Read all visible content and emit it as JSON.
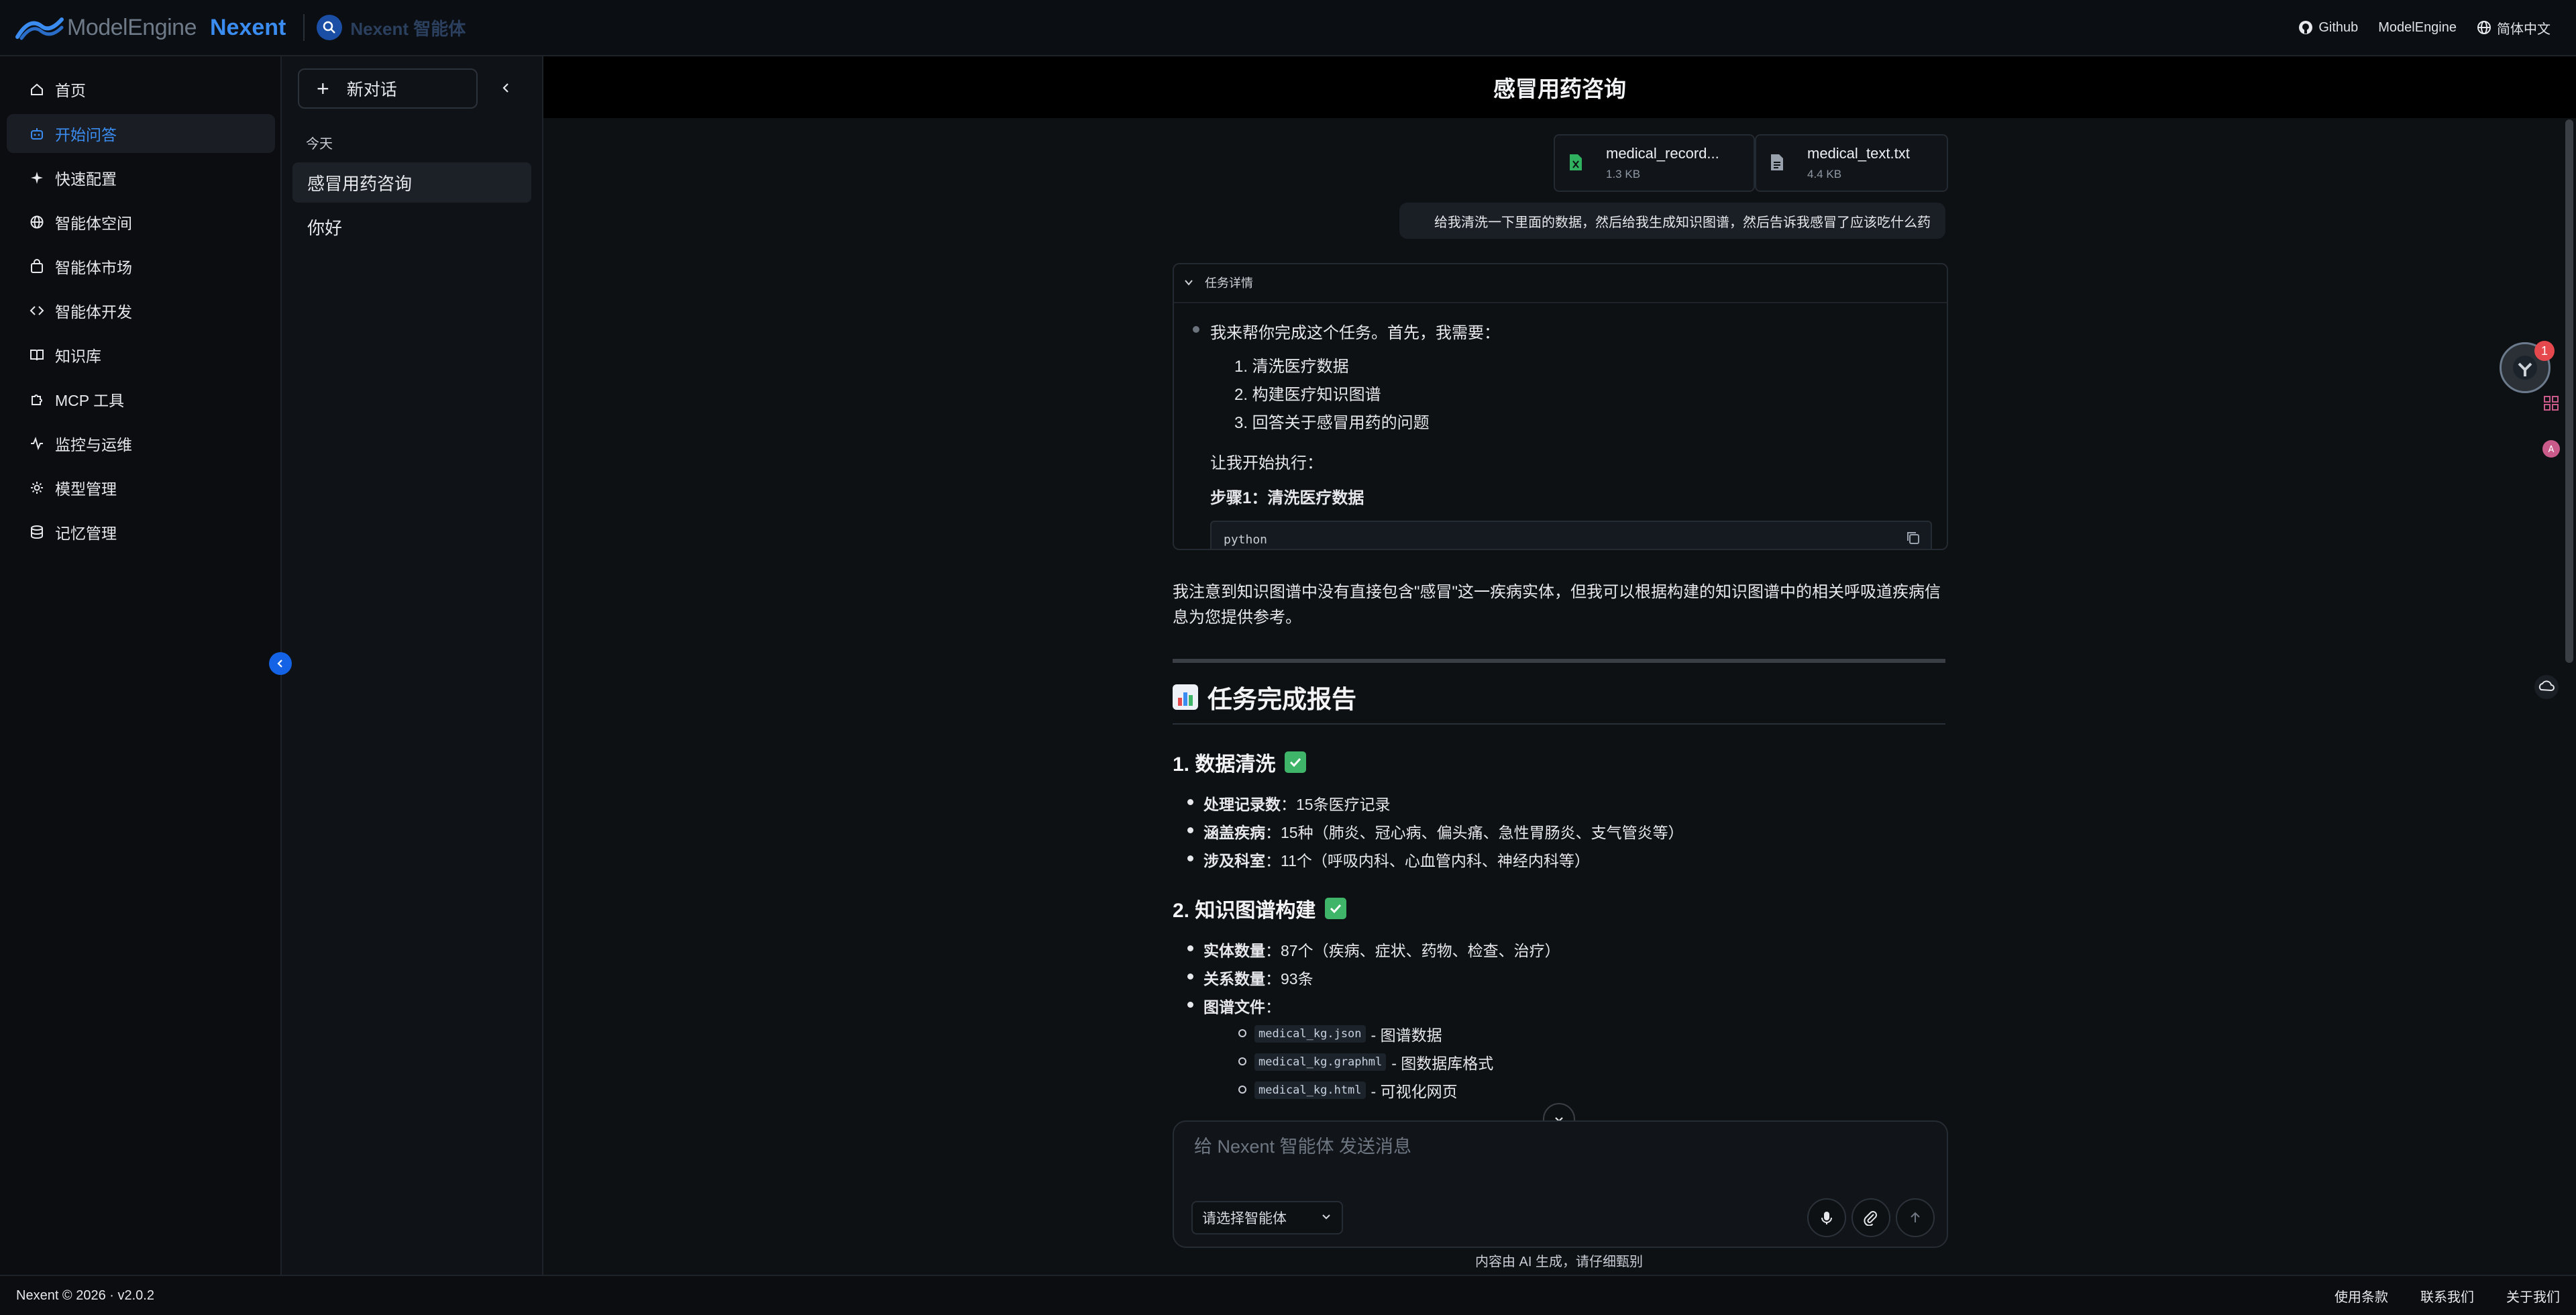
{
  "header": {
    "logo_text": "ModelEngine",
    "brand": "Nexent",
    "agent_label": "Nexent 智能体",
    "right_links": [
      "Github",
      "ModelEngine",
      "简体中文"
    ]
  },
  "sidebar": {
    "items": [
      {
        "label": "首页",
        "icon": "home-icon"
      },
      {
        "label": "开始问答",
        "icon": "chat-bot-icon",
        "active": true
      },
      {
        "label": "快速配置",
        "icon": "sparkle-icon"
      },
      {
        "label": "智能体空间",
        "icon": "globe-icon"
      },
      {
        "label": "智能体市场",
        "icon": "shop-bag-icon"
      },
      {
        "label": "智能体开发",
        "icon": "code-icon"
      },
      {
        "label": "知识库",
        "icon": "book-icon"
      },
      {
        "label": "MCP 工具",
        "icon": "puzzle-icon"
      },
      {
        "label": "监控与运维",
        "icon": "activity-icon"
      },
      {
        "label": "模型管理",
        "icon": "settings-icon"
      },
      {
        "label": "记忆管理",
        "icon": "database-icon"
      }
    ]
  },
  "conversations": {
    "new_chat": "新对话",
    "group_label": "今天",
    "items": [
      "感冒用药咨询",
      "你好"
    ]
  },
  "chat": {
    "title": "感冒用药咨询",
    "files": [
      {
        "name": "medical_record...",
        "size": "1.3 KB",
        "type": "excel"
      },
      {
        "name": "medical_text.txt",
        "size": "4.4 KB",
        "type": "text"
      }
    ],
    "user_message": "给我清洗一下里面的数据，然后给我生成知识图谱，然后告诉我感冒了应该吃什么药",
    "task": {
      "header": "任务详情",
      "intro": "我来帮你完成这个任务。首先，我需要：",
      "steps": [
        "1. 清洗医疗数据",
        "2. 构建医疗知识图谱",
        "3. 回答关于感冒用药的问题"
      ],
      "start": "让我开始执行：",
      "step1": "步骤1：清洗医疗数据",
      "code_lang": "python"
    },
    "note": "我注意到知识图谱中没有直接包含\"感冒\"这一疾病实体，但我可以根据构建的知识图谱中的相关呼吸道疾病信息为您提供参考。",
    "report_title": "任务完成报告",
    "sec1": {
      "title": "1. 数据清洗",
      "bullets": [
        {
          "k": "处理记录数",
          "v": "：15条医疗记录"
        },
        {
          "k": "涵盖疾病",
          "v": "：15种（肺炎、冠心病、偏头痛、急性胃肠炎、支气管炎等）"
        },
        {
          "k": "涉及科室",
          "v": "：11个（呼吸内科、心血管内科、神经内科等）"
        }
      ]
    },
    "sec2": {
      "title": "2. 知识图谱构建",
      "bullets": [
        {
          "k": "实体数量",
          "v": "：87个（疾病、症状、药物、检查、治疗）"
        },
        {
          "k": "关系数量",
          "v": "：93条"
        },
        {
          "k": "图谱文件",
          "v": "："
        }
      ],
      "files": [
        {
          "code": "medical_kg.json",
          "desc": "- 图谱数据"
        },
        {
          "code": "medical_kg.graphml",
          "desc": "- 图数据库格式"
        },
        {
          "code": "medical_kg.html",
          "desc": "- 可视化网页"
        }
      ]
    }
  },
  "composer": {
    "placeholder": "给 Nexent 智能体 发送消息",
    "agent_select": "请选择智能体",
    "disclaimer": "内容由 AI 生成，请仔细甄别"
  },
  "floating": {
    "badge": "1"
  },
  "footer": {
    "copyright": "Nexent © 2026 · v2.0.2",
    "links": [
      "使用条款",
      "联系我们",
      "关于我们"
    ]
  },
  "colors": {
    "accent": "#3b8cf0",
    "brand_blue": "#1463e6",
    "check_green": "#3fb56a",
    "badge_red": "#e5484d"
  }
}
